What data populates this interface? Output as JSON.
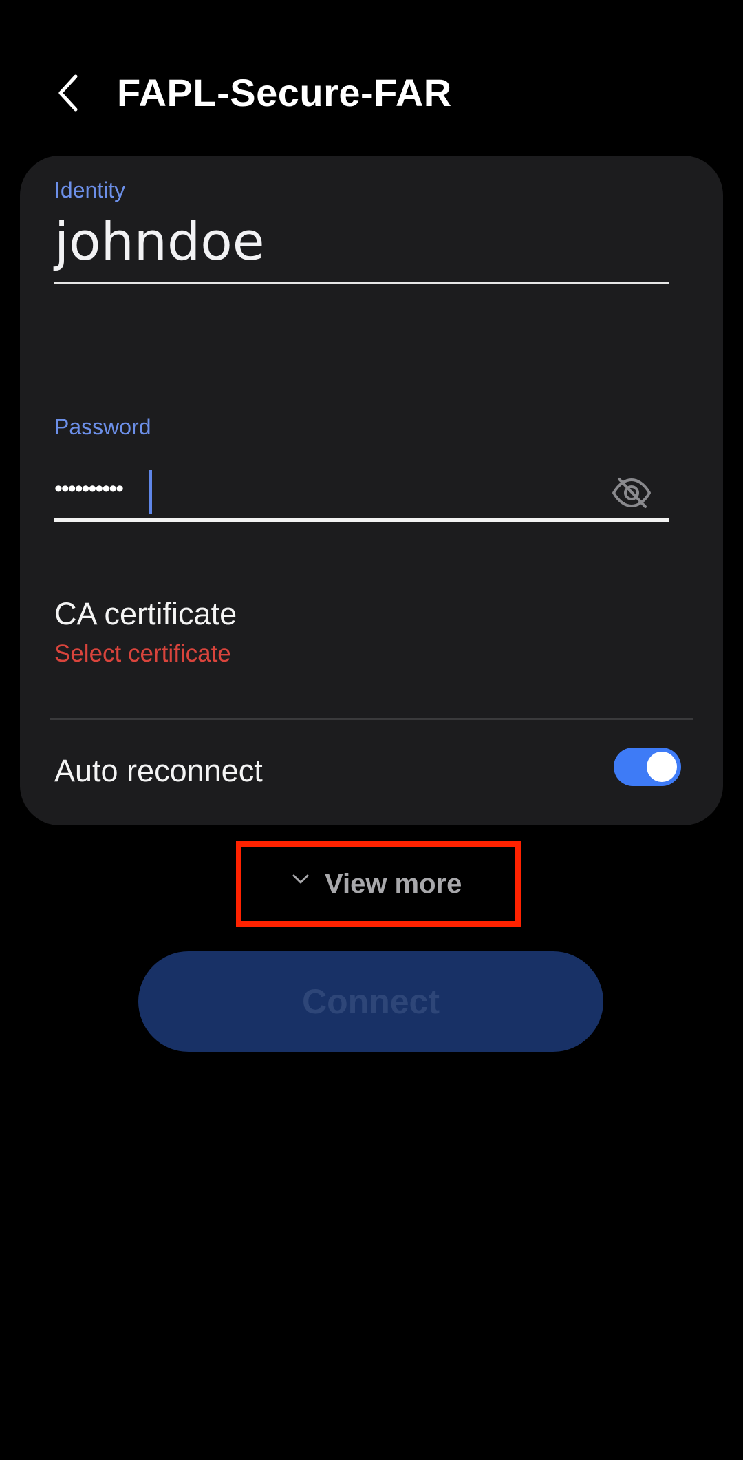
{
  "header": {
    "title": "FAPL-Secure-FAR",
    "back_icon": "chevron-left-icon"
  },
  "identity": {
    "label": "Identity",
    "value": "johndoe"
  },
  "password": {
    "label": "Password",
    "masked_value": "••••••••••",
    "visibility_icon": "eye-off-icon"
  },
  "ca_certificate": {
    "title": "CA certificate",
    "subtitle": "Select certificate"
  },
  "auto_reconnect": {
    "label": "Auto reconnect",
    "enabled": true
  },
  "view_more": {
    "label": "View more",
    "icon": "chevron-down-icon"
  },
  "connect": {
    "label": "Connect",
    "enabled": false
  },
  "colors": {
    "accent": "#3e7bf6",
    "label_blue": "#6c8fe8",
    "error_red": "#d9443c",
    "highlight": "#ff2200",
    "card_bg": "#1c1c1e",
    "connect_bg": "#183166"
  }
}
